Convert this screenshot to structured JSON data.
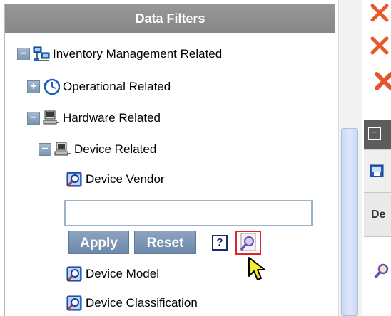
{
  "panel": {
    "title": "Data Filters"
  },
  "tree": {
    "root": {
      "label": "Inventory Management Related",
      "toggle": "−"
    },
    "operational": {
      "label": "Operational Related",
      "toggle": "+"
    },
    "hardware": {
      "label": "Hardware Related",
      "toggle": "−"
    },
    "device": {
      "label": "Device Related",
      "toggle": "−"
    },
    "vendor": {
      "label": "Device Vendor"
    },
    "model": {
      "label": "Device Model"
    },
    "classification": {
      "label": "Device Classification"
    }
  },
  "filter": {
    "value": "",
    "placeholder": "",
    "apply_label": "Apply",
    "reset_label": "Reset",
    "help_label": "?"
  },
  "right_panel": {
    "collapse_label": "−",
    "column_label": "De"
  },
  "icons": {
    "network": "network-icon",
    "clock": "clock-icon",
    "computer": "computer-icon",
    "report": "report-lookup-icon",
    "delete": "delete-x-icon"
  },
  "colors": {
    "header_bg": "#8f8f8f",
    "button_bg": "#7c97b8",
    "toggle_bg": "#8ea4c0",
    "highlight_border": "#e0242a",
    "delete_icon": "#e04a2a"
  }
}
